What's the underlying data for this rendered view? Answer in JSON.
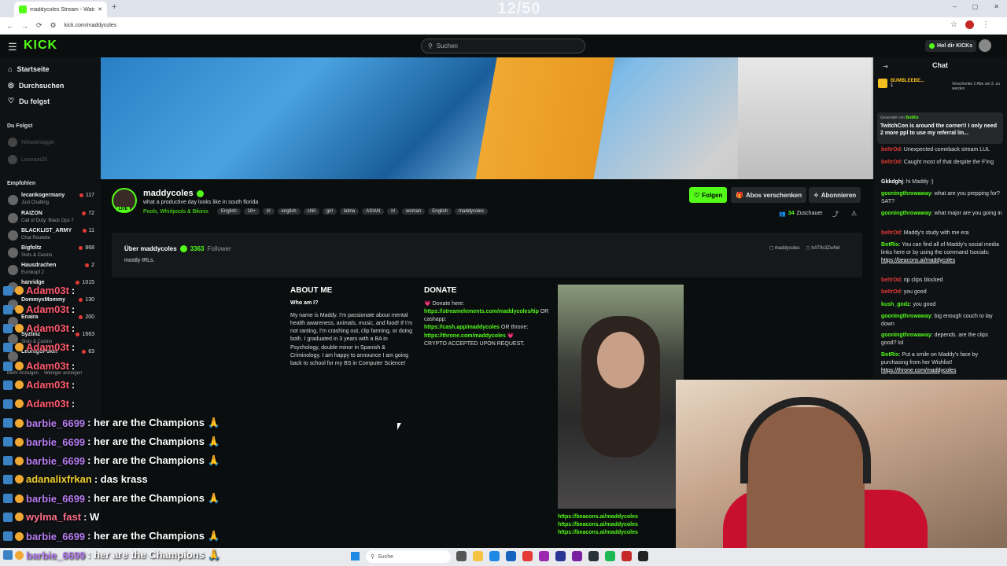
{
  "browser": {
    "tab_title": "maddycoles Stream - Watch Li...",
    "new_tab_glyph": "+",
    "url": "kick.com/maddycoles",
    "window_controls": [
      "–",
      "▢",
      "✕"
    ]
  },
  "overlay_counter": "12/50",
  "header": {
    "logo": "KICK",
    "search_placeholder": "Suchen",
    "kicks_label": "Hol dir KICKs"
  },
  "sidebar": {
    "nav": [
      {
        "label": "Startseite",
        "icon": "home-icon"
      },
      {
        "label": "Durchsuchen",
        "icon": "compass-icon"
      },
      {
        "label": "Du folgst",
        "icon": "heart-icon"
      }
    ],
    "following_title": "Du Folgst",
    "following": [
      "Nikiwieisiggie",
      "Leonam20"
    ],
    "recommended_title": "Empfohlen",
    "recommended": [
      {
        "name": "lecankogermany",
        "category": "Just Chatting",
        "viewers": "117"
      },
      {
        "name": "RAIZON",
        "category": "Call of Duty: Black Ops 7",
        "viewers": "72"
      },
      {
        "name": "BLACKLIST_ARMY",
        "category": "Chat Roulette",
        "viewers": "11"
      },
      {
        "name": "Bigfoltz",
        "category": "Slots & Casino",
        "viewers": "868"
      },
      {
        "name": "Hausdrachen",
        "category": "Eurokopf 2",
        "viewers": "2"
      },
      {
        "name": "hanridge",
        "category": "",
        "viewers": "1015"
      },
      {
        "name": "DommyxMommy",
        "category": "",
        "viewers": "130"
      },
      {
        "name": "Enaira",
        "category": "",
        "viewers": "200"
      },
      {
        "name": "Syztmz",
        "category": "Slots & Casino",
        "viewers": "1663"
      },
      {
        "name": "LeonigoPoker",
        "category": "",
        "viewers": "63"
      }
    ],
    "show_more": "Mehr Anzeigen",
    "show_less": "Weniger anzeigen"
  },
  "channel": {
    "name": "maddycoles",
    "live_label": "LIVE",
    "title": "what a productive day looks like in south florida",
    "category": "Pools, Whirlpools & Bikinis",
    "tags": [
      "English",
      "18+",
      "irl",
      "english",
      "chill",
      "girl",
      "latina",
      "ASIAN",
      "irl",
      "woman",
      "English",
      "maddycoles"
    ],
    "follow_button": "Folgen",
    "gift_subs_button": "Abos verschenken",
    "subscribe_button": "Abonnieren",
    "viewer_count": "34",
    "viewer_label": "Zuschauer"
  },
  "about": {
    "heading": "Über maddycoles",
    "followers_count": "3363",
    "followers_label": "Follower",
    "description": "mostly IRLs.",
    "social_1": "maddycoles",
    "social_2": "hAT9s3ZwNd"
  },
  "panels": {
    "about_me_title": "ABOUT ME",
    "who_am_i": "Who am I?",
    "about_me_text": "My name is Maddy. I'm passionate about mental health awareness, animals, music, and food! If I'm not ranting, I'm crashing out, clip farming, or doing both. I graduated in 3 years with a BA in Psychology, double minor in Spanish & Criminology. I am happy to announce I am going back to school for my BS in Computer Science!",
    "donate_title": "DONATE",
    "donate_intro": "💗 Donate here:",
    "donate_link_1": "https://streamelements.com/maddycoles/tip",
    "donate_or_cashapp": " OR cashapp:",
    "donate_link_2": "https://cash.app/maddycoles",
    "donate_or_throne": " OR throne:",
    "donate_link_3": "https://throne.com/maddycoles",
    "donate_heart": " 💗",
    "donate_crypto": "CRYPTO ACCEPTED UPON REQUEST.",
    "beacons_links": [
      "https://beacons.ai/maddycoles",
      "https://beacons.ai/maddycoles",
      "https://beacons.ai/maddycoles"
    ]
  },
  "chat": {
    "title": "Chat",
    "leaderboard_name": "BUMBLEEBE...",
    "leaderboard_count": "1",
    "gift_hint": "Verschenke 1 Abo um 2. zu werden",
    "pinned_by_label": "Gesendet von",
    "pinned_by": "BotRix",
    "pinned_text": "TwitchCon is around the corner!! I only need 2 more ppl to use my referral lin...",
    "messages": [
      {
        "user": "beltrOd",
        "color": "#e53935",
        "text": ": Unexpected comeback stream LUL"
      },
      {
        "user": "beltrOd",
        "color": "#e53935",
        "text": ": Caught most of that despite the F'ing"
      },
      {
        "user": "Gkkdghj",
        "color": "#ffffff",
        "text": ": hi Maddy :)"
      },
      {
        "user": "gooningthrowaway",
        "color": "#53fc18",
        "text": ": what are you prepping for? SAT?"
      },
      {
        "user": "gooningthrowaway",
        "color": "#53fc18",
        "text": ": what major are you going in"
      },
      {
        "user": "beltrOd",
        "color": "#e53935",
        "text": ": Maddy's study with me era"
      },
      {
        "user": "BotRix",
        "color": "#53fc18",
        "text": ": You can find all of Maddy's social media links here or by using the command !socials: ",
        "link": "https://beacons.ai/maddycoles"
      },
      {
        "user": "beltrOd",
        "color": "#e53935",
        "text": ": rip clips blocked"
      },
      {
        "user": "beltrOd",
        "color": "#e53935",
        "text": ": you good"
      },
      {
        "user": "kush_godz",
        "color": "#53fc18",
        "text": ": you good"
      },
      {
        "user": "gooningthrowaway",
        "color": "#53fc18",
        "text": ": big enough couch to lay down"
      },
      {
        "user": "gooningthrowaway",
        "color": "#53fc18",
        "text": ": depends. are the clips good? lol"
      },
      {
        "user": "BotRix",
        "color": "#53fc18",
        "text": ": Put a smile on Maddy's face by purchasing from her Wishlist! ",
        "link": "https://throne.com/maddycoles"
      }
    ]
  },
  "overlay_chat": [
    {
      "user": "Adam03t",
      "color": "#ff5a6e",
      "text": " :"
    },
    {
      "user": "Adam03t",
      "color": "#ff5a6e",
      "text": " :"
    },
    {
      "user": "Adam03t",
      "color": "#ff5a6e",
      "text": " :"
    },
    {
      "user": "Adam03t",
      "color": "#ff5a6e",
      "text": " :"
    },
    {
      "user": "Adam03t",
      "color": "#ff5a6e",
      "text": " :"
    },
    {
      "user": "Adam03t",
      "color": "#ff5a6e",
      "text": " :"
    },
    {
      "user": "Adam03t",
      "color": "#ff5a6e",
      "text": " :"
    },
    {
      "user": "barbie_6699",
      "color": "#b57cf0",
      "text": " : her are the Champions 🙏"
    },
    {
      "user": "barbie_6699",
      "color": "#b57cf0",
      "text": " : her are the Champions 🙏"
    },
    {
      "user": "barbie_6699",
      "color": "#b57cf0",
      "text": " : her are the Champions 🙏"
    },
    {
      "user": "adanalixfrkan",
      "color": "#f0d030",
      "text": " : das krass"
    },
    {
      "user": "barbie_6699",
      "color": "#b57cf0",
      "text": " : her are the Champions 🙏"
    },
    {
      "user": "wylma_fast",
      "color": "#ff6f8a",
      "text": " : W"
    },
    {
      "user": "barbie_6699",
      "color": "#b57cf0",
      "text": " : her are the Champions 🙏"
    },
    {
      "user": "barbie_6699",
      "color": "#b57cf0",
      "text": " : her are the Champions 🙏"
    }
  ],
  "taskbar": {
    "search_placeholder": "Suche"
  },
  "colors": {
    "accent": "#53fc18",
    "background": "#0b0e0f",
    "panel": "#16191b"
  }
}
